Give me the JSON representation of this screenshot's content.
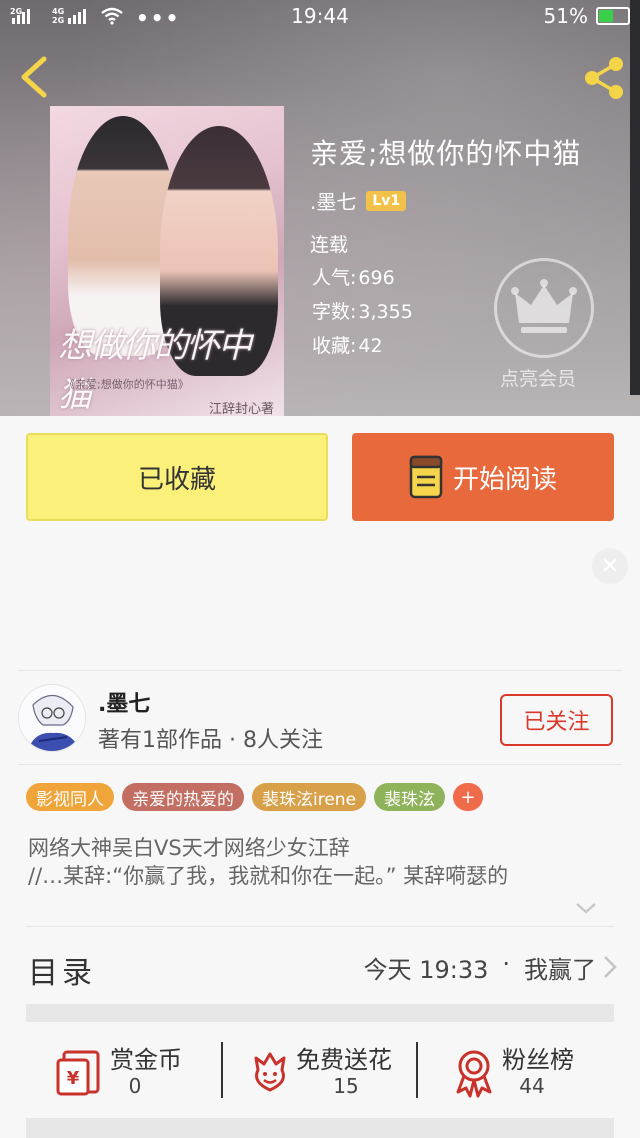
{
  "status_bar": {
    "signal_left": "2G",
    "signal_mid": "4G/2G",
    "time": "19:44",
    "battery_percent": "51%",
    "battery_level": 0.51
  },
  "book": {
    "title": "亲爱;想做你的怀中猫",
    "author": ".墨七",
    "author_level": "Lv1",
    "status": "连载",
    "popularity_label": "人气",
    "popularity_value": "696",
    "wordcount_label": "字数",
    "wordcount_value": "3,355",
    "favorites_label": "收藏",
    "favorites_value": "42",
    "cover_title": "想做你的怀中猫",
    "cover_subtitle": "《亲爱;想做你的怀中猫》",
    "cover_author": "江辞封心著"
  },
  "vip": {
    "label": "点亮会员"
  },
  "buttons": {
    "collected": "已收藏",
    "start_reading": "开始阅读"
  },
  "author_card": {
    "name": ".墨七",
    "stats": "著有1部作品 · 8人关注",
    "follow": "已关注"
  },
  "tags": [
    {
      "label": "影视同人",
      "color": "#f0a53b"
    },
    {
      "label": "亲爱的热爱的",
      "color": "#c26e62"
    },
    {
      "label": "裴珠泫irene",
      "color": "#d9a04a"
    },
    {
      "label": "裴珠泫",
      "color": "#8fb35a"
    }
  ],
  "tag_more": "+",
  "description": {
    "line1": "网络大神吴白VS天才网络少女江辞",
    "line2": "//…某辞:“你赢了我，我就和你在一起。” 某辞嗬瑟的"
  },
  "toc": {
    "label": "目录",
    "latest_time": "今天 19:33",
    "separator": "·",
    "latest_chapter": "我赢了"
  },
  "actions": [
    {
      "label": "赏金币",
      "count": "0",
      "icon": "red-envelope-icon"
    },
    {
      "label": "免费送花",
      "count": "15",
      "icon": "flower-icon"
    },
    {
      "label": "粉丝榜",
      "count": "44",
      "icon": "ribbon-medal-icon"
    }
  ],
  "colors": {
    "accent_orange": "#e8693c",
    "collected_yellow": "#fbf07a",
    "follow_red": "#d9382b",
    "icon_red": "#c8322a"
  }
}
